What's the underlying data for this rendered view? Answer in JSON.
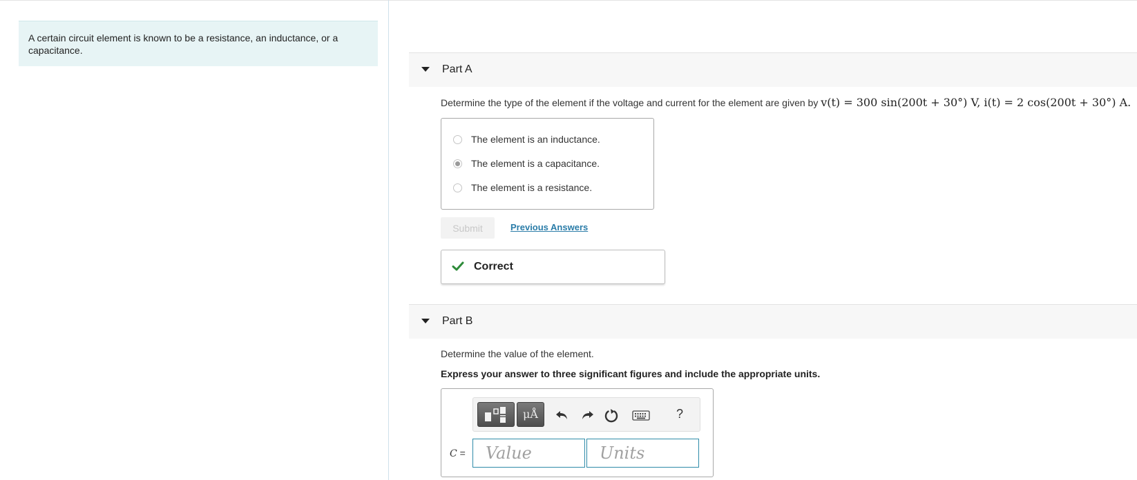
{
  "intro": {
    "text": "A certain circuit element is known to be a resistance, an inductance, or a capacitance."
  },
  "part_a": {
    "title": "Part A",
    "question_prefix": "Determine the type of the element if the voltage and current for the element are given by",
    "question_math": "v(t) = 300 sin(200t + 30°) V, i(t) = 2 cos(200t + 30°) A.",
    "choices": [
      {
        "label": "The element is an inductance.",
        "selected": false
      },
      {
        "label": "The element is a capacitance.",
        "selected": true
      },
      {
        "label": "The element is a resistance.",
        "selected": false
      }
    ],
    "submit_label": "Submit",
    "previous_answers_label": "Previous Answers",
    "feedback": "Correct",
    "feedback_color": "#2e8b3a"
  },
  "part_b": {
    "title": "Part B",
    "question": "Determine the value of the element.",
    "instruction": "Express your answer to three significant figures and include the appropriate units.",
    "toolbar": {
      "templates_icon": "templates-icon",
      "units_glyph": "μÅ",
      "undo_icon": "undo-icon",
      "redo_icon": "redo-icon",
      "reset_icon": "reset-icon",
      "keyboard_icon": "keyboard-icon",
      "help_label": "?"
    },
    "variable_letter": "C",
    "variable_equals": " =",
    "value_placeholder": "Value",
    "units_placeholder": "Units"
  }
}
